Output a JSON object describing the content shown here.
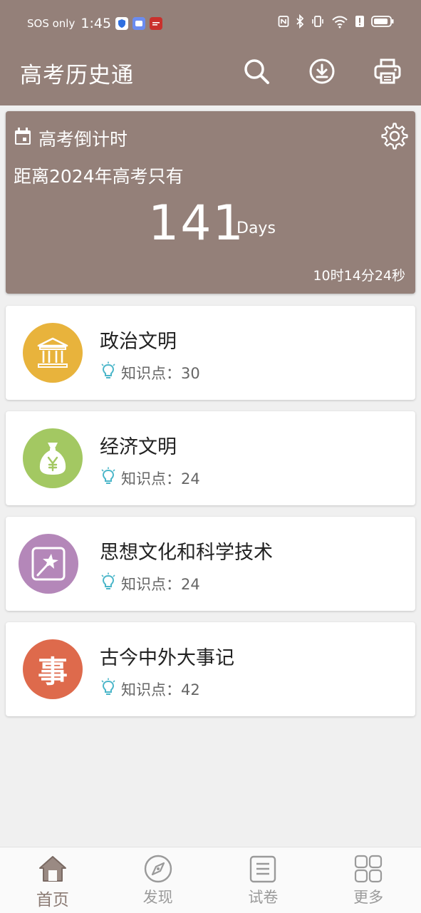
{
  "status": {
    "sos": "SOS only",
    "time": "1:45"
  },
  "app": {
    "title": "高考历史通"
  },
  "countdown": {
    "label": "高考倒计时",
    "subtitle": "距离2024年高考只有",
    "days": "141",
    "days_unit": "Days",
    "remaining": "10时14分24秒"
  },
  "topics": [
    {
      "title": "政治文明",
      "meta": "知识点：30",
      "icon": "bank-icon",
      "color": "#e8b33c"
    },
    {
      "title": "经济文明",
      "meta": "知识点：24",
      "icon": "money-bag-icon",
      "color": "#a3c862"
    },
    {
      "title": "思想文化和科学技术",
      "meta": "知识点：24",
      "icon": "magic-star-icon",
      "color": "#b487b9"
    },
    {
      "title": "古今中外大事记",
      "meta": "知识点：42",
      "icon": "event-char-icon",
      "color": "#de6a4c",
      "icon_char": "事"
    }
  ],
  "nav": [
    {
      "label": "首页",
      "icon": "home-icon",
      "active": true
    },
    {
      "label": "发现",
      "icon": "compass-icon",
      "active": false
    },
    {
      "label": "试卷",
      "icon": "paper-icon",
      "active": false
    },
    {
      "label": "更多",
      "icon": "grid-icon",
      "active": false
    }
  ],
  "colors": {
    "brand": "#948079",
    "nav_active": "#8b7b74",
    "nav_inactive": "#9a9a9a",
    "bulb": "#4bb6c9"
  }
}
